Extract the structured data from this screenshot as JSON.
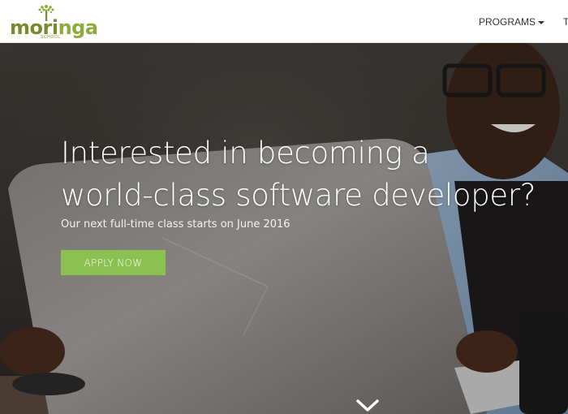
{
  "navbar": {
    "logo": {
      "wordmark_prefix": "mor",
      "wordmark_middle": "i",
      "wordmark_suffix": "nga",
      "subtext": "SCHOOL",
      "icon": "tree-icon"
    },
    "menu": [
      {
        "label": "PROGRAMS",
        "icon": "caret-down-icon"
      },
      {
        "label": "TE"
      }
    ]
  },
  "hero": {
    "title_line1": "Interested in becoming a",
    "title_line2": "world-class software developer?",
    "subtitle": "Our next full-time class starts on June 2016",
    "cta_label": "APPLY NOW",
    "scroll_icon": "chevron-down-icon"
  },
  "colors": {
    "brand_green": "#8cc152",
    "logo_olive": "#7a8a2a",
    "nav_text": "#333333",
    "hero_text": "#ffffff"
  }
}
